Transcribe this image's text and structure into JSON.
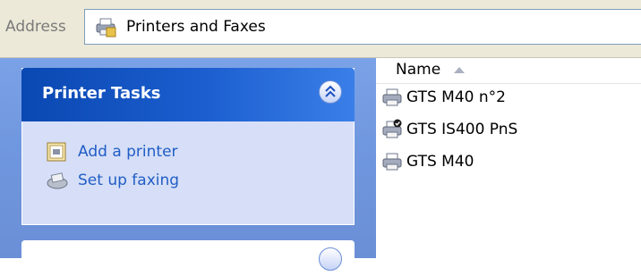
{
  "address": {
    "label": "Address",
    "value": "Printers and Faxes",
    "icon": "printers-folder-icon"
  },
  "task_pane": {
    "printer_tasks": {
      "title": "Printer Tasks",
      "items": [
        {
          "label": "Add a printer",
          "icon": "add-printer-icon"
        },
        {
          "label": "Set up faxing",
          "icon": "fax-icon"
        }
      ]
    }
  },
  "list": {
    "column_header": "Name",
    "sort": "ascending",
    "items": [
      {
        "name": "GTS M40 n°2",
        "icon": "printer-icon",
        "default": false
      },
      {
        "name": "GTS IS400 PnS",
        "icon": "printer-icon",
        "default": true
      },
      {
        "name": "GTS M40",
        "icon": "printer-icon",
        "default": false
      }
    ]
  },
  "colors": {
    "pane_blue": "#6f97df",
    "header_blue": "#0a48b2",
    "link_blue": "#215dc6",
    "panel_bg": "#d6dff7"
  }
}
